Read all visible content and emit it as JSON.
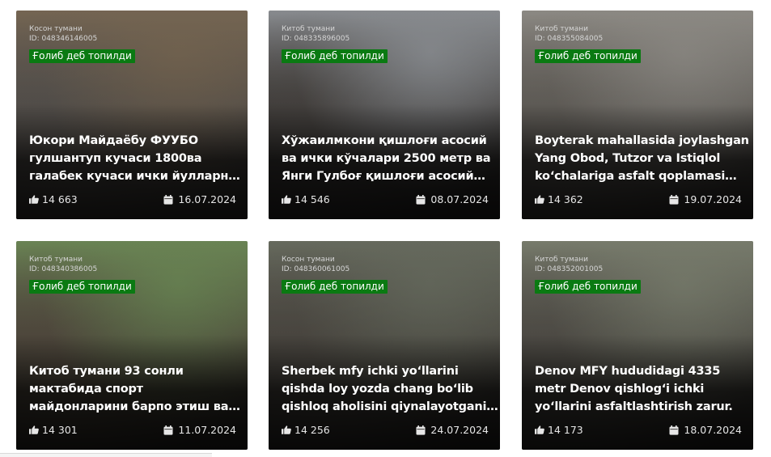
{
  "cards": [
    {
      "district": "Косон тумани",
      "id_text": "ID: 048346146005",
      "status": "Ғолиб деб топилди",
      "title_lines": [
        "Юкори Майдаёбу ФУУБО",
        "гулшантуп кучаси 1800ва",
        "галабек кучаси ички йулларн…"
      ],
      "likes": "14 663",
      "date": "16.07.2024",
      "colors": {
        "a": "#7a6a56",
        "b": "#5f5a55",
        "c": "#3e3b38"
      }
    },
    {
      "district": "Китоб тумани",
      "id_text": "ID: 048335896005",
      "status": "Ғолиб деб топилди",
      "title_lines": [
        "Хўжаилмкони қишлоғи асосий",
        "ва ички кўчалари 2500 метр ва",
        "Янги Гулбоғ қишлоғи асосий…"
      ],
      "likes": "14 546",
      "date": "08.07.2024",
      "colors": {
        "a": "#8f9296",
        "b": "#4e4a47",
        "c": "#2d2b2a"
      }
    },
    {
      "district": "Китоб тумани",
      "id_text": "ID: 048355084005",
      "status": "Ғолиб деб топилди",
      "title_lines": [
        "Boyterak mahallasida joylashgan",
        "Yang Obod, Tutzor va Istiqlol",
        "koʻchalariga asfalt qoplamasi…"
      ],
      "likes": "14 362",
      "date": "19.07.2024",
      "colors": {
        "a": "#93908a",
        "b": "#6e6a64",
        "c": "#3a3734"
      }
    },
    {
      "district": "Китоб тумани",
      "id_text": "ID: 048340386005",
      "status": "Ғолиб деб топилди",
      "title_lines": [
        "Китоб тумани 93 сонли",
        "мактабида спорт",
        "майдонларини барпо этиш ва…"
      ],
      "likes": "14 301",
      "date": "11.07.2024",
      "colors": {
        "a": "#6f8a58",
        "b": "#5b5346",
        "c": "#2f2d2a"
      }
    },
    {
      "district": "Косон тумани",
      "id_text": "ID: 048360061005",
      "status": "Ғолиб деб топилди",
      "title_lines": [
        "Sherbek mfy ichki yoʻllarini",
        "qishda loy yozda chang boʻlib",
        "qishloq aholisini qiynalayotgani…"
      ],
      "likes": "14 256",
      "date": "24.07.2024",
      "colors": {
        "a": "#6b6f62",
        "b": "#55514a",
        "c": "#2c2a28"
      }
    },
    {
      "district": "Китоб тумани",
      "id_text": "ID: 048352001005",
      "status": "Ғолиб деб топилди",
      "title_lines": [
        "Denov MFY hududidagi 4335",
        "metr Denov qishlogʻi ichki",
        "yoʻllarini asfaltlashtirish zarur."
      ],
      "likes": "14 173",
      "date": "18.07.2024",
      "colors": {
        "a": "#7d8171",
        "b": "#5a5750",
        "c": "#2d2b29"
      }
    }
  ],
  "icons": {
    "likes": "thumbs-up-icon",
    "date": "calendar-icon"
  },
  "accent": "#0a7a12"
}
